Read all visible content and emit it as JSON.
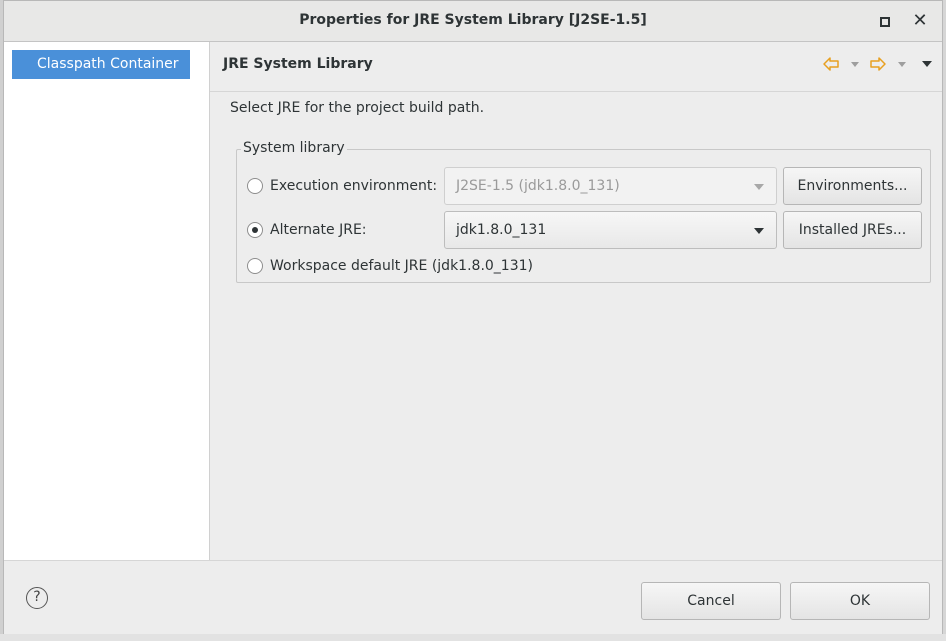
{
  "dialog": {
    "title": "Properties for JRE System Library [J2SE-1.5]"
  },
  "nav": {
    "items": [
      {
        "label": "Classpath Container",
        "selected": true
      }
    ]
  },
  "page": {
    "title": "JRE System Library",
    "description": "Select JRE for the project build path.",
    "nav_icons": [
      "back-arrow-icon",
      "back-dropdown-icon",
      "forward-arrow-icon",
      "forward-dropdown-icon",
      "view-menu-icon"
    ]
  },
  "system_library": {
    "group_label": "System library",
    "execution_environment": {
      "label": "Execution environment:",
      "selected": false,
      "value": "J2SE-1.5 (jdk1.8.0_131)",
      "enabled": false,
      "button": "Environments..."
    },
    "alternate_jre": {
      "label": "Alternate JRE:",
      "selected": true,
      "value": "jdk1.8.0_131",
      "button": "Installed JREs..."
    },
    "workspace_default": {
      "label": "Workspace default JRE (jdk1.8.0_131)",
      "selected": false
    }
  },
  "footer": {
    "help_icon": "question-mark-icon",
    "help_glyph": "?",
    "cancel": "Cancel",
    "ok": "OK"
  },
  "colors": {
    "selection": "#4a90d9",
    "arrow_icon": "#e8a020"
  }
}
